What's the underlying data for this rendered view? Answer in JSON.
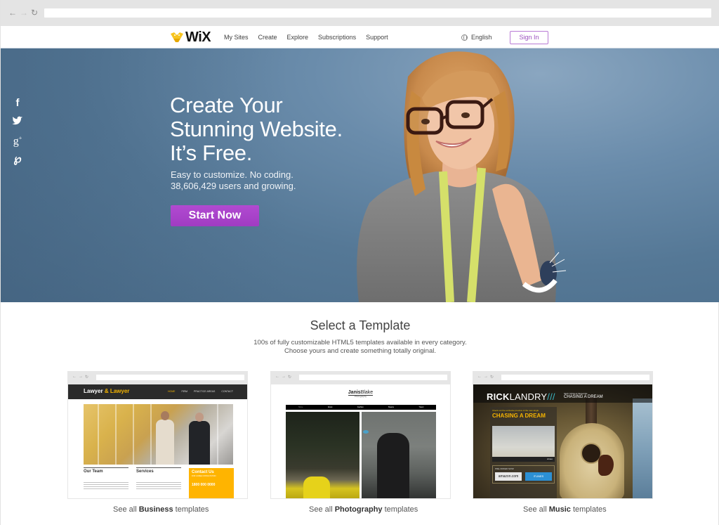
{
  "browser": {
    "back_icon": "arrow-left-icon",
    "forward_icon": "arrow-right-icon",
    "reload_icon": "reload-icon",
    "url": ""
  },
  "header": {
    "logo_text": "WiX",
    "nav": [
      "My Sites",
      "Create",
      "Explore",
      "Subscriptions",
      "Support"
    ],
    "language": "English",
    "language_icon": "globe-icon",
    "signin_label": "Sign In",
    "accent_color": "#a43fc5"
  },
  "hero": {
    "social_icons": [
      "facebook-icon",
      "twitter-icon",
      "google-plus-icon",
      "pinterest-icon"
    ],
    "social_glyphs": [
      "f",
      "❚",
      "g+",
      "p"
    ],
    "headline_lines": [
      "Create Your",
      "Stunning Website.",
      "It’s Free."
    ],
    "subline_1": "Easy to customize. No coding.",
    "subline_2": "38,606,429 users and growing.",
    "cta_label": "Start Now",
    "cta_color": "#a43fc5"
  },
  "templates": {
    "title": "Select a Template",
    "desc_1": "100s of fully customizable HTML5 templates available in every category.",
    "desc_2": "Choose yours and create something totally original.",
    "cards": [
      {
        "category": "Business",
        "link_prefix": "See all ",
        "link_suffix": " templates",
        "preview": {
          "brand_1": "Lawyer",
          "brand_amp": "&",
          "brand_2": "Lawyer",
          "nav": [
            "HOME",
            "FIRM",
            "PRACTICE AREAS",
            "CONTACT"
          ],
          "col_1": "Our Team",
          "col_2": "Services",
          "contact_title": "Contact Us",
          "contact_sub": "FOR A FREE CONSULTATION",
          "contact_phone": "1800 000 0000"
        }
      },
      {
        "category": "Photography",
        "link_prefix": "See all ",
        "link_suffix": " templates",
        "preview": {
          "brand_1": "Janis",
          "brand_2": "Blake",
          "sub": "Photography",
          "nav": [
            "Home",
            "About",
            "Fashion",
            "Beauty",
            "Travel"
          ]
        }
      },
      {
        "category": "Music",
        "link_prefix": "See all ",
        "link_suffix": " templates",
        "preview": {
          "brand_1": "RICK",
          "brand_2": "LANDRY",
          "slashes": "///",
          "tag_small": "NEW SINGLE RELEASE",
          "tag_big": "CHASING A DREAM",
          "panel_pre": "Check out the exclusive preview of the new single",
          "panel_title": "CHASING A DREAM",
          "video_brand": "vimeo",
          "preorder": "PRE-ORDER NOW!",
          "amazon": "amazon.com",
          "itunes": "iTUNES"
        }
      }
    ]
  }
}
